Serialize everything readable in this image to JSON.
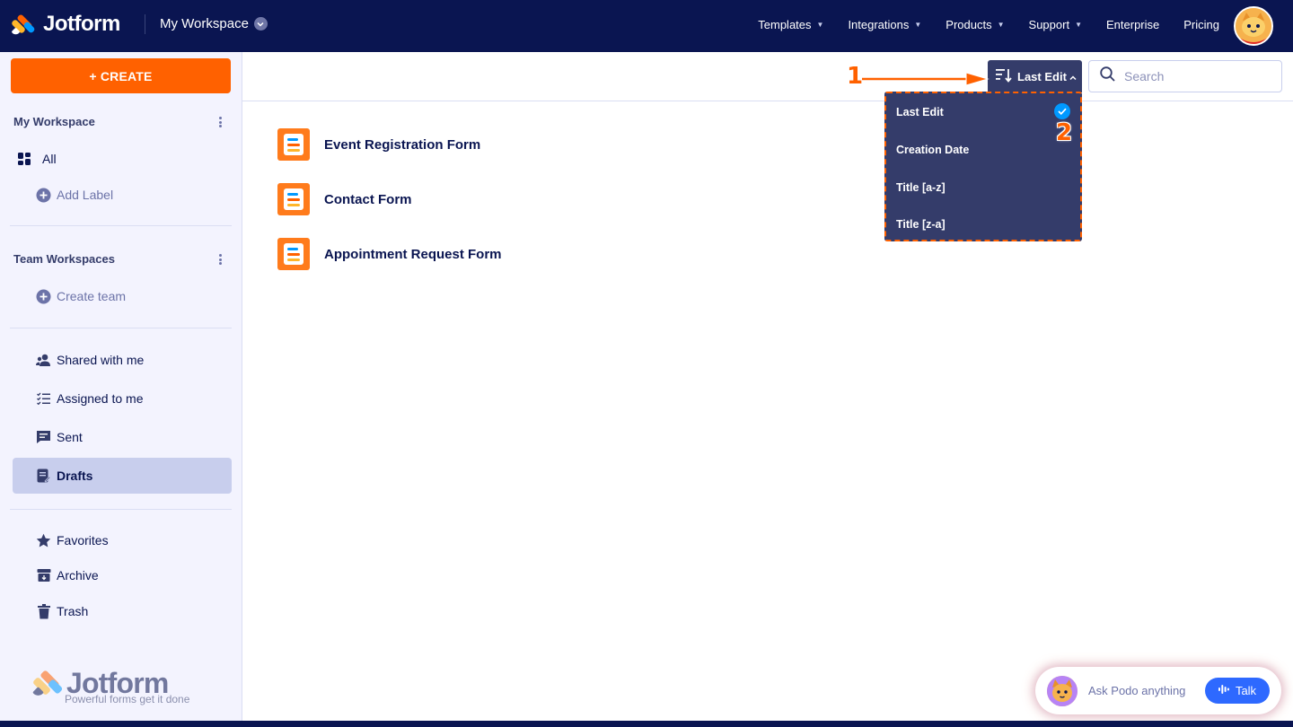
{
  "topnav": {
    "brand": "Jotform",
    "workspace": "My Workspace",
    "links": [
      "Templates",
      "Integrations",
      "Products",
      "Support",
      "Enterprise",
      "Pricing"
    ]
  },
  "sidebar": {
    "create_label": "+ CREATE",
    "my_workspace_title": "My Workspace",
    "all_label": "All",
    "add_label": "Add Label",
    "team_workspaces_title": "Team Workspaces",
    "create_team": "Create team",
    "shared": "Shared with me",
    "assigned": "Assigned to me",
    "sent": "Sent",
    "drafts": "Drafts",
    "favorites": "Favorites",
    "archive": "Archive",
    "trash": "Trash",
    "brand": "Jotform",
    "tagline": "Powerful forms get it done"
  },
  "toolbar": {
    "sort_label": "Last Edit",
    "search_placeholder": "Search"
  },
  "sort_menu": {
    "options": [
      "Last Edit",
      "Creation Date",
      "Title [a-z]",
      "Title [z-a]"
    ],
    "selected": "Last Edit"
  },
  "annotations": {
    "step1": "1",
    "step2": "2"
  },
  "forms": [
    {
      "title": "Event Registration Form"
    },
    {
      "title": "Contact Form"
    },
    {
      "title": "Appointment Request Form"
    }
  ],
  "podo": {
    "prompt": "Ask Podo anything",
    "talk_label": "Talk"
  },
  "colors": {
    "navy": "#0a1551",
    "orange": "#ff6100",
    "menu": "#343c6a",
    "active_bg": "#c8ceed",
    "check": "#0099ff",
    "talk": "#2e69ff"
  }
}
